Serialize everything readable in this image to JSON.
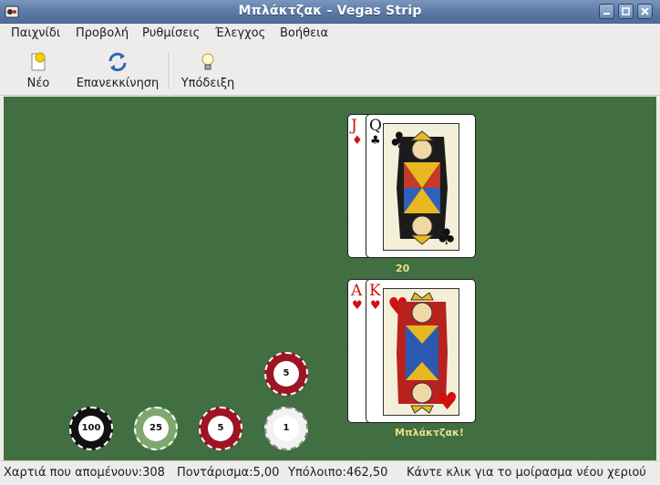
{
  "window": {
    "title": "Μπλάκτζακ - Vegas Strip"
  },
  "menu": {
    "items": [
      "Παιχνίδι",
      "Προβολή",
      "Ρυθμίσεις",
      "Έλεγχος",
      "Βοήθεια"
    ]
  },
  "toolbar": {
    "new_label": "Νέο",
    "restart_label": "Επανεκκίνηση",
    "hint_label": "Υπόδειξη"
  },
  "dealer": {
    "cards": [
      {
        "rank": "J",
        "suit": "♦",
        "color": "red"
      },
      {
        "rank": "Q",
        "suit": "♣",
        "color": "black"
      }
    ],
    "score": "20"
  },
  "player": {
    "cards": [
      {
        "rank": "A",
        "suit": "♥",
        "color": "red"
      },
      {
        "rank": "K",
        "suit": "♥",
        "color": "red"
      }
    ],
    "result": "Μπλάκτζακ!"
  },
  "chips": {
    "bet_chip": "5",
    "rack": [
      "100",
      "25",
      "5",
      "1"
    ]
  },
  "colors": {
    "felt": "#3f6d3f",
    "chip_100": "#111111",
    "chip_25": "#7fa86f",
    "chip_5": "#9b1525",
    "chip_1": "#f2f2f2"
  },
  "status": {
    "cards_left": "Χαρτιά που απομένουν:308",
    "bet": "Ποντάρισμα:5,00",
    "balance": "Υπόλοιπο:462,50",
    "message": "Κάντε κλικ για το μοίρασμα νέου χεριού"
  }
}
